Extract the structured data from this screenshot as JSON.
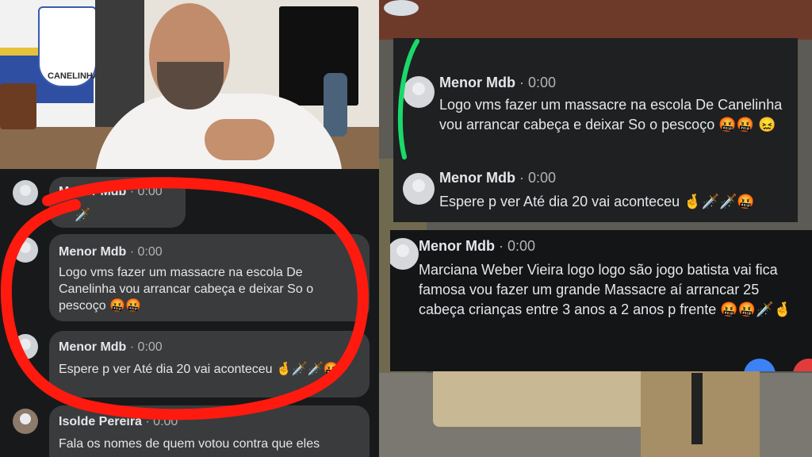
{
  "photo": {
    "crest_text": "CANELINHA"
  },
  "left_comments": [
    {
      "author": "Menor Mdb",
      "time": "· 0:00",
      "text": "🗡️"
    },
    {
      "author": "Menor Mdb",
      "time": "· 0:00",
      "text": "Logo vms fazer um massacre na escola De Canelinha vou arrancar cabeça e deixar So o pescoço 🤬🤬"
    },
    {
      "author": "Menor Mdb",
      "time": "· 0:00",
      "text": "Espere p ver Até dia 20 vai aconteceu 🤞🗡️🗡️🤬"
    },
    {
      "author": "Isolde Pereira",
      "time": "· 0:00",
      "text": "Fala os nomes de quem votou contra que eles"
    }
  ],
  "card_a": [
    {
      "author": "Menor Mdb",
      "time": "· 0:00",
      "text": "Logo vms fazer um massacre na escola De Canelinha vou arrancar cabeça e deixar So o pescoço 🤬🤬 😖"
    },
    {
      "author": "Menor Mdb",
      "time": "· 0:00",
      "text": "Espere p ver Até dia 20 vai aconteceu 🤞🗡️🗡️🤬"
    }
  ],
  "card_b": {
    "author": "Menor Mdb",
    "time": "· 0:00",
    "text": "Marciana Weber Vieira logo logo são jogo batista vai fica famosa vou fazer um grande Massacre aí arrancar 25 cabeça crianças entre 3 anos a 2 anos p frente 🤬🤬🗡️🤞"
  },
  "colors": {
    "highlight_circle": "#ff1a0f",
    "green_arc": "#19d96b",
    "bubble": "#3a3b3c",
    "background": "#18191a"
  }
}
